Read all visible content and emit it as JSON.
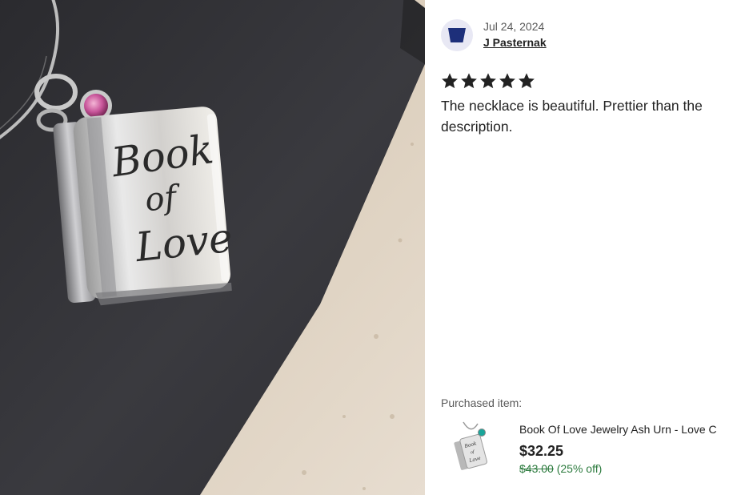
{
  "review": {
    "date": "Jul 24, 2024",
    "author": "J Pasternak",
    "rating": 5,
    "text": "The necklace is beautiful. Prettier than the description."
  },
  "purchased": {
    "label": "Purchased item:",
    "title": "Book Of Love Jewelry Ash Urn - Love C",
    "price": "$32.25",
    "original_price": "$43.00",
    "discount": "(25% off)"
  },
  "photo": {
    "engraving_line1": "Book",
    "engraving_line2": "of",
    "engraving_line3": "Love"
  },
  "colors": {
    "discount_green": "#2b7a3d",
    "avatar_blue": "#1d2f7a",
    "star": "#222222"
  }
}
